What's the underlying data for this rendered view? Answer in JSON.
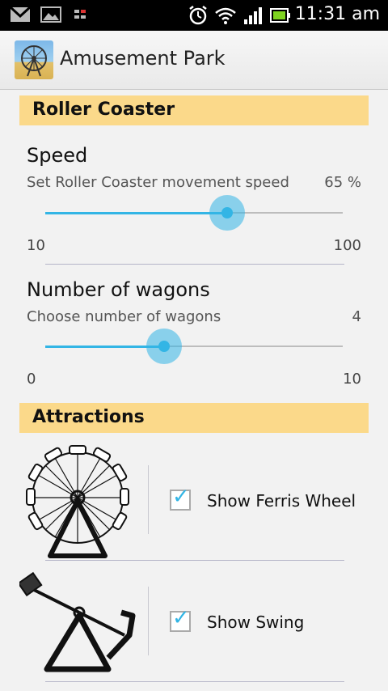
{
  "status_bar": {
    "time": "11:31 am",
    "icons": [
      "gmail-icon",
      "gallery-icon",
      "network-activity-icon",
      "alarm-icon",
      "wifi-icon",
      "signal-icon",
      "battery-icon"
    ]
  },
  "action_bar": {
    "title": "Amusement Park",
    "icon": "ferris-wheel-app-icon"
  },
  "roller_coaster": {
    "header": "Roller Coaster",
    "speed": {
      "title": "Speed",
      "summary": "Set Roller Coaster movement speed",
      "value_text": "65 %",
      "value": 65,
      "min_label": "10",
      "max_label": "100",
      "min": 10,
      "max": 100
    },
    "wagons": {
      "title": "Number of wagons",
      "summary": "Choose number of wagons",
      "value_text": "4",
      "value": 4,
      "min_label": "0",
      "max_label": "10",
      "min": 0,
      "max": 10
    }
  },
  "attractions": {
    "header": "Attractions",
    "items": [
      {
        "label": "Show Ferris Wheel",
        "checked": true,
        "icon": "ferris-wheel-icon"
      },
      {
        "label": "Show Swing",
        "checked": true,
        "icon": "swing-icon"
      }
    ]
  },
  "colors": {
    "accent": "#33b5e5",
    "section_header": "#fbd98a",
    "status_bar": "#000000"
  }
}
